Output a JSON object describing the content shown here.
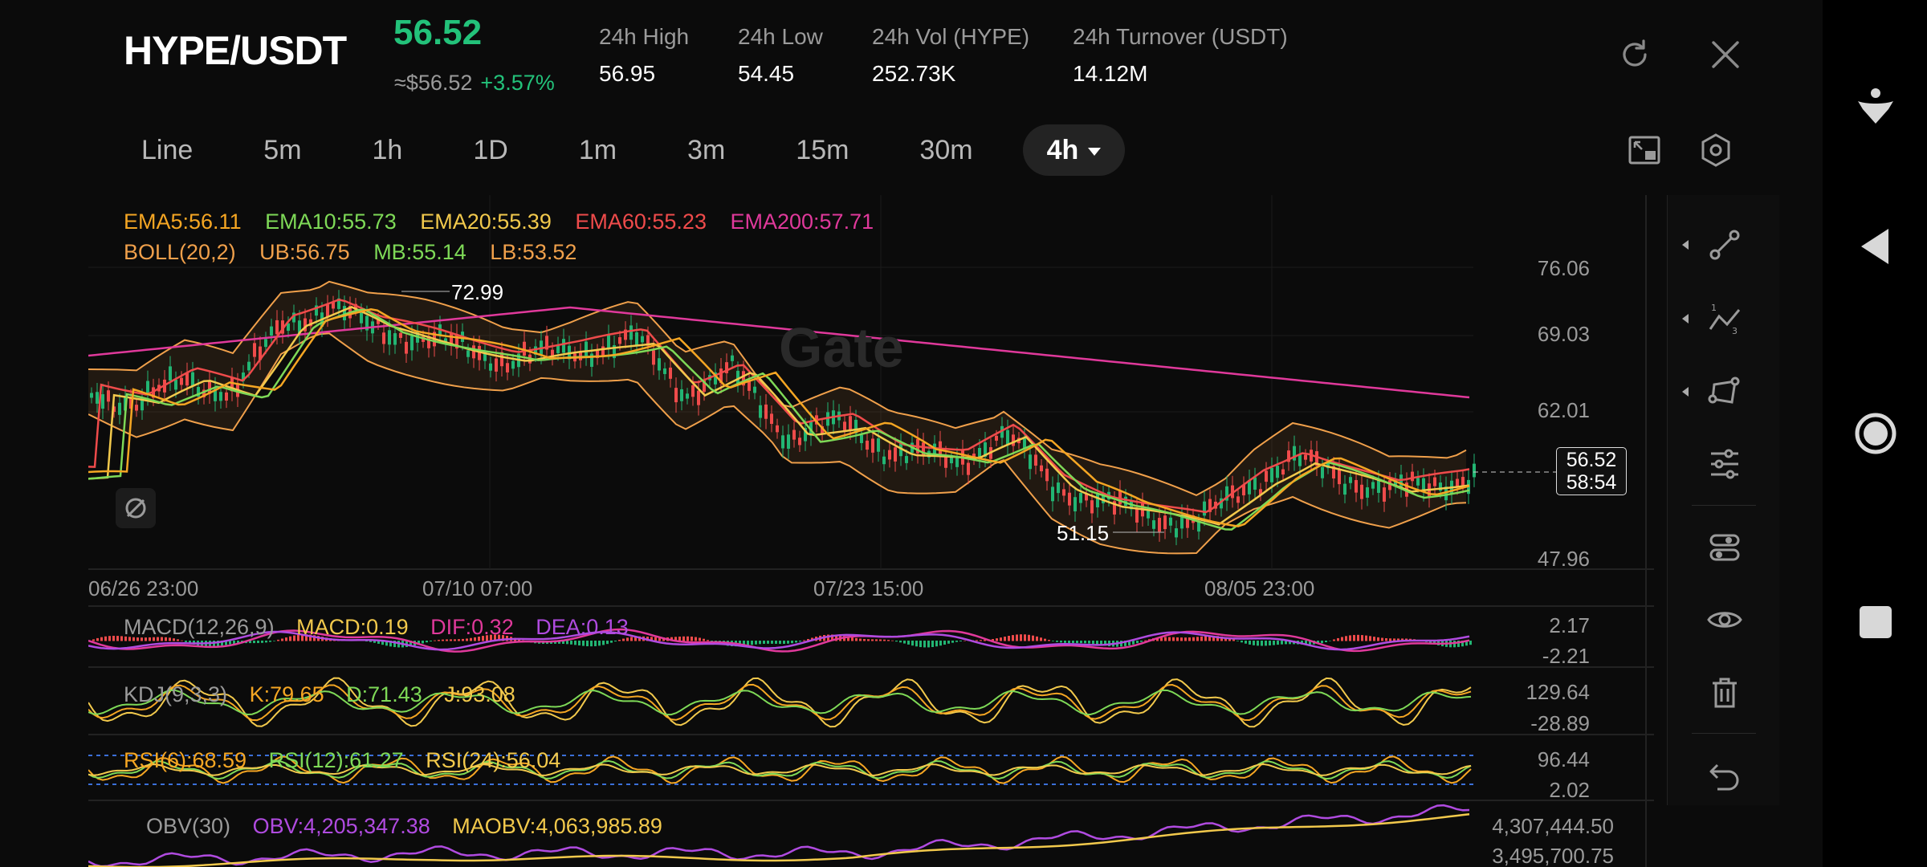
{
  "header": {
    "pair": "HYPE/USDT",
    "price": "56.52",
    "approx_price": "≈$56.52",
    "change": "+3.57%",
    "stats": [
      {
        "label": "24h   High",
        "value": "56.95"
      },
      {
        "label": "24h   Low",
        "value": "54.45"
      },
      {
        "label": "24h   Vol (HYPE)",
        "value": "252.73K"
      },
      {
        "label": "24h   Turnover (USDT)",
        "value": "14.12M"
      }
    ],
    "icons": [
      "refresh-icon",
      "close-icon"
    ]
  },
  "timeframes": {
    "items": [
      "Line",
      "5m",
      "1h",
      "1D",
      "1m",
      "3m",
      "15m",
      "30m"
    ],
    "active": "4h",
    "tools": [
      "fullscreen-icon",
      "settings-icon"
    ]
  },
  "main_chart": {
    "ema_legend": [
      {
        "text": "EMA5:56.11",
        "color": "#f5a623"
      },
      {
        "text": "EMA10:55.73",
        "color": "#7ed957"
      },
      {
        "text": "EMA20:55.39",
        "color": "#f2c94c"
      },
      {
        "text": "EMA60:55.23",
        "color": "#ef4b4b"
      },
      {
        "text": "EMA200:57.71",
        "color": "#e0399b"
      }
    ],
    "boll_legend": [
      {
        "text": "BOLL(20,2)",
        "color": "#f0a04b"
      },
      {
        "text": "UB:56.75",
        "color": "#f0a04b"
      },
      {
        "text": "MB:55.14",
        "color": "#7ed957"
      },
      {
        "text": "LB:53.52",
        "color": "#f0a04b"
      }
    ],
    "y_labels": [
      "76.06",
      "69.03",
      "62.01",
      "47.96"
    ],
    "x_labels": [
      "06/26 23:00",
      "07/10 07:00",
      "07/23 15:00",
      "08/05 23:00"
    ],
    "high_marker": "72.99",
    "low_marker": "51.15",
    "last_price": "56.52",
    "countdown": "58:54",
    "watermark": "Gate"
  },
  "macd": {
    "legend": [
      {
        "text": "MACD(12,26,9)",
        "color": "#9a9a9a"
      },
      {
        "text": "MACD:0.19",
        "color": "#f2c94c"
      },
      {
        "text": "DIF:0.32",
        "color": "#e0399b"
      },
      {
        "text": "DEA:0.13",
        "color": "#b04be0"
      }
    ],
    "y_labels": [
      "2.17",
      "-2.21"
    ]
  },
  "kdj": {
    "legend": [
      {
        "text": "KDJ(9,3,3)",
        "color": "#9a9a9a"
      },
      {
        "text": "K:79.65",
        "color": "#f5a623"
      },
      {
        "text": "D:71.43",
        "color": "#7ed957"
      },
      {
        "text": "J:93.08",
        "color": "#f2c94c"
      }
    ],
    "y_labels": [
      "129.64",
      "-28.89"
    ]
  },
  "rsi": {
    "legend": [
      {
        "text": "RSI(6):68.59",
        "color": "#f5a623"
      },
      {
        "text": "RSI(12):61.27",
        "color": "#7ed957"
      },
      {
        "text": "RSI(24):56.04",
        "color": "#f2c94c"
      }
    ],
    "y_labels": [
      "96.44",
      "2.02"
    ]
  },
  "obv": {
    "legend": [
      {
        "text": "OBV(30)",
        "color": "#9a9a9a"
      },
      {
        "text": "OBV:4,205,347.38",
        "color": "#b04be0"
      },
      {
        "text": "MAOBV:4,063,985.89",
        "color": "#f2c94c"
      }
    ],
    "y_labels": [
      "4,307,444.50",
      "3,495,700.75"
    ]
  },
  "toolbar": {
    "tools": [
      "trendline-icon",
      "fibonacci-icon",
      "shape-icon",
      "indicator-settings-icon",
      "layout-icon",
      "visibility-icon",
      "delete-icon",
      "undo-icon"
    ]
  },
  "android_nav": [
    "accessibility-icon",
    "back-icon",
    "home-icon",
    "recents-icon"
  ]
}
